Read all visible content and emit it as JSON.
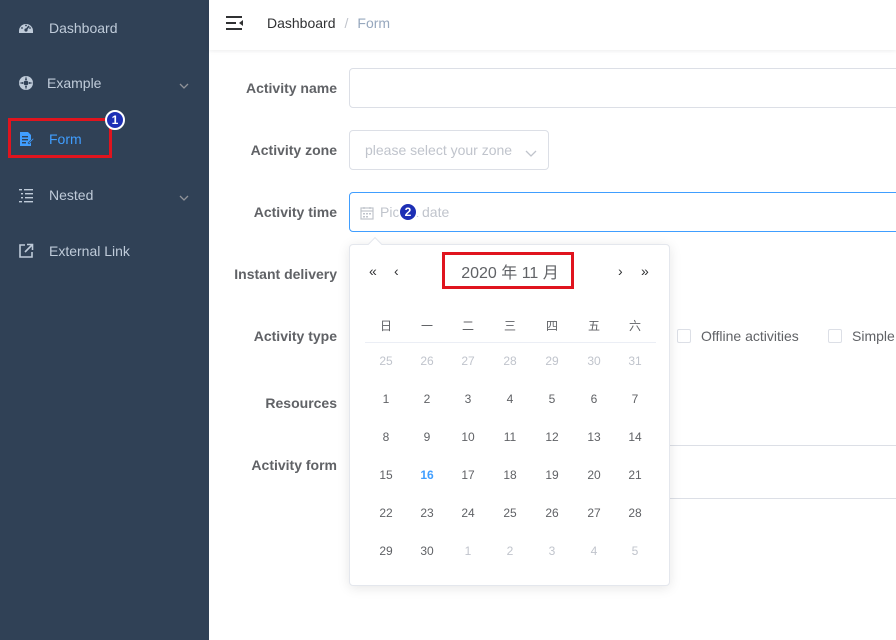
{
  "sidebar": {
    "items": [
      {
        "label": "Dashboard",
        "icon": "dashboard-icon"
      },
      {
        "label": "Example",
        "icon": "example-icon",
        "has_submenu": true
      },
      {
        "label": "Form",
        "icon": "form-icon",
        "active": true
      },
      {
        "label": "Nested",
        "icon": "nested-icon",
        "has_submenu": true
      },
      {
        "label": "External Link",
        "icon": "external-link-icon"
      }
    ]
  },
  "annotations": {
    "badge1": "1",
    "badge2": "2"
  },
  "breadcrumb": {
    "home": "Dashboard",
    "separator": "/",
    "current": "Form"
  },
  "form": {
    "name_label": "Activity name",
    "zone_label": "Activity zone",
    "zone_placeholder": "please select your zone",
    "time_label": "Activity time",
    "time_placeholder": "Pick a date",
    "delivery_label": "Instant delivery",
    "type_label": "Activity type",
    "type_options": [
      "Offline activities",
      "Simple"
    ],
    "resources_label": "Resources",
    "activity_form_label": "Activity form"
  },
  "datepicker": {
    "title": "2020 年  11 月",
    "prev_year": "«",
    "prev_month": "‹",
    "next_month": "›",
    "next_year": "»",
    "weekdays": [
      "日",
      "一",
      "二",
      "三",
      "四",
      "五",
      "六"
    ],
    "today": "16",
    "rows": [
      [
        {
          "d": "25",
          "o": true
        },
        {
          "d": "26",
          "o": true
        },
        {
          "d": "27",
          "o": true
        },
        {
          "d": "28",
          "o": true
        },
        {
          "d": "29",
          "o": true
        },
        {
          "d": "30",
          "o": true
        },
        {
          "d": "31",
          "o": true
        }
      ],
      [
        {
          "d": "1"
        },
        {
          "d": "2"
        },
        {
          "d": "3"
        },
        {
          "d": "4"
        },
        {
          "d": "5"
        },
        {
          "d": "6"
        },
        {
          "d": "7"
        }
      ],
      [
        {
          "d": "8"
        },
        {
          "d": "9"
        },
        {
          "d": "10"
        },
        {
          "d": "11"
        },
        {
          "d": "12"
        },
        {
          "d": "13"
        },
        {
          "d": "14"
        }
      ],
      [
        {
          "d": "15"
        },
        {
          "d": "16"
        },
        {
          "d": "17"
        },
        {
          "d": "18"
        },
        {
          "d": "19"
        },
        {
          "d": "20"
        },
        {
          "d": "21"
        }
      ],
      [
        {
          "d": "22"
        },
        {
          "d": "23"
        },
        {
          "d": "24"
        },
        {
          "d": "25"
        },
        {
          "d": "26"
        },
        {
          "d": "27"
        },
        {
          "d": "28"
        }
      ],
      [
        {
          "d": "29"
        },
        {
          "d": "30"
        },
        {
          "d": "1",
          "o": true
        },
        {
          "d": "2",
          "o": true
        },
        {
          "d": "3",
          "o": true
        },
        {
          "d": "4",
          "o": true
        },
        {
          "d": "5",
          "o": true
        }
      ]
    ]
  },
  "colors": {
    "sidebar_bg": "#304156",
    "accent": "#409eff",
    "highlight": "#e0141e",
    "badge": "#1d2fb5"
  }
}
